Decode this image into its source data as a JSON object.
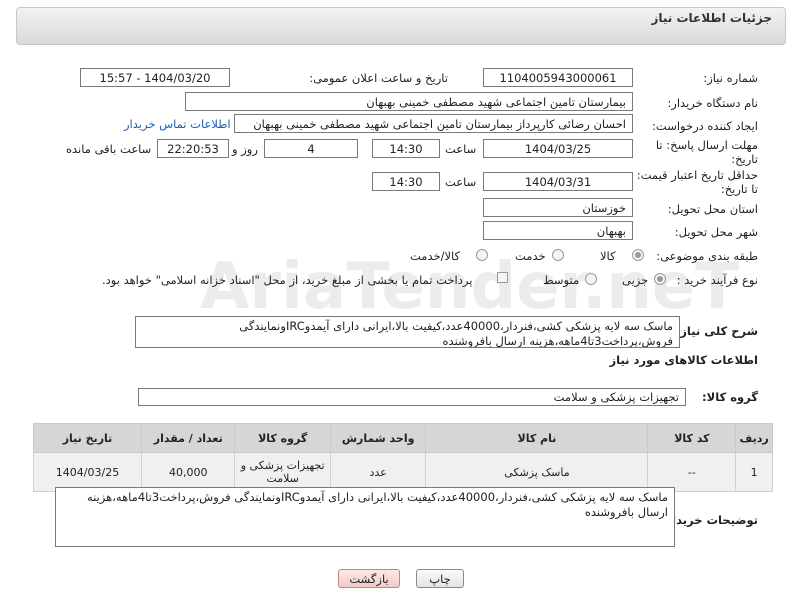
{
  "header": {
    "title": "جزئیات اطلاعات نیاز"
  },
  "form": {
    "need_number_label": "شماره نیاز:",
    "need_number": "1104005943000061",
    "announce_label": "تاریخ و ساعت اعلان عمومی:",
    "announce_value": "1404/03/20 - 15:57",
    "buyer_org_label": "نام دستگاه خریدار:",
    "buyer_org": "بیمارستان تامین اجتماعی شهید مصطفی خمینی بهبهان",
    "creator_label": "ایجاد کننده درخواست:",
    "creator": "احسان رضائی کارپرداز بیمارستان تامین اجتماعی شهید مصطفی خمینی بهبهان",
    "buyer_contact_link": "اطلاعات تماس خریدار",
    "reply_deadline_label": "مهلت ارسال پاسخ: تا تاریخ:",
    "reply_date": "1404/03/25",
    "time_label": "ساعت",
    "reply_time": "14:30",
    "days_count": "4",
    "days_label": "روز و",
    "remaining_time": "22:20:53",
    "remaining_label": "ساعت باقی مانده",
    "price_validity_label": "حداقل تاریخ اعتبار قیمت: تا تاریخ:",
    "price_date": "1404/03/31",
    "price_time": "14:30",
    "province_label": "استان محل تحویل:",
    "province": "خوزستان",
    "city_label": "شهر محل تحویل:",
    "city": "بهبهان",
    "category_label": "طبقه بندی موضوعی:",
    "category_options": [
      "کالا",
      "خدمت",
      "کالا/خدمت"
    ],
    "process_label": "نوع فرآیند خرید :",
    "process_options": [
      "جزیی",
      "متوسط"
    ],
    "payment_note": "پرداخت تمام یا بخشی از مبلغ خرید، از محل \"اسناد خزانه اسلامی\" خواهد بود.",
    "description_label": "شرح کلی نیاز:",
    "description": "ماسک سه لایه پزشکی کشی،فنردار،40000عدد،کیفیت بالا،ایرانی دارای آیمدوIRCونمایندگی فروش،پرداخت3تا4ماهه،هزینه ارسال بافروشنده"
  },
  "goods": {
    "section_title": "اطلاعات کالاهای مورد نیاز",
    "group_label": "گروه کالا:",
    "group_value": "تجهیزات پزشکی و سلامت",
    "columns": [
      "ردیف",
      "کد کالا",
      "نام کالا",
      "واحد شمارش",
      "گروه کالا",
      "تعداد / مقدار",
      "تاریخ نیاز"
    ],
    "rows": [
      {
        "row": "1",
        "code": "--",
        "name": "ماسک پزشکی",
        "unit": "عدد",
        "group": "تجهیزات پزشکی و سلامت",
        "qty": "40,000",
        "date": "1404/03/25"
      }
    ]
  },
  "buyer_notes": {
    "label": "توضیحات خریدار:",
    "text": "ماسک سه لایه پزشکی کشی،فنردار،40000عدد،کیفیت بالا،ایرانی دارای آیمدوIRCونمایندگی فروش،پرداخت3تا4ماهه،هزینه ارسال بافروشنده"
  },
  "buttons": {
    "print": "چاپ",
    "back": "بازگشت"
  },
  "watermark": "AriaTender.neT"
}
